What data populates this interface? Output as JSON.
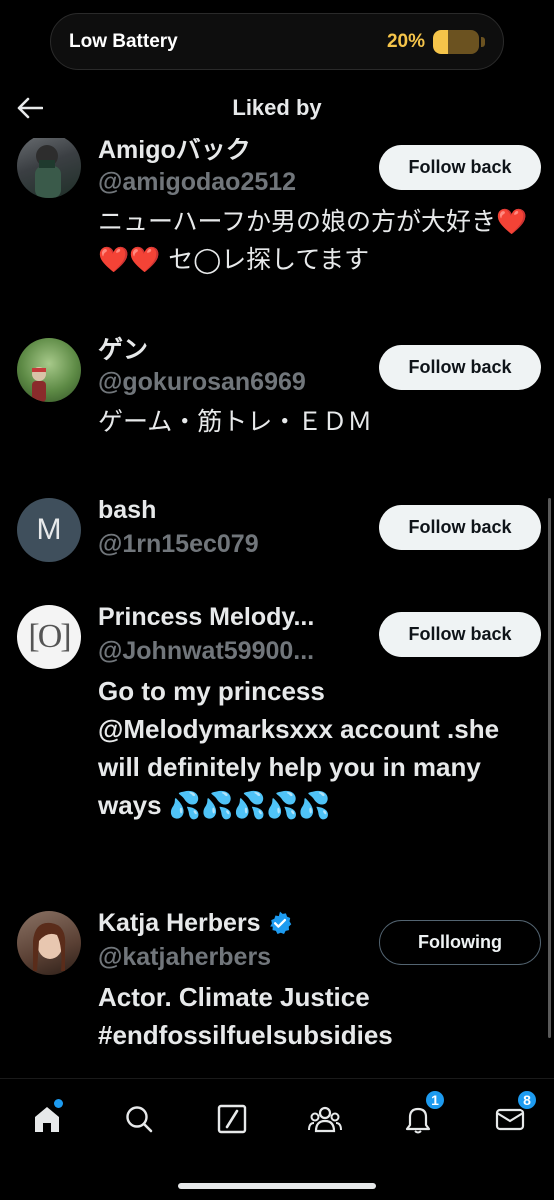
{
  "status": {
    "label": "Low Battery",
    "battery_percent_text": "20%",
    "battery_level": 0.2,
    "battery_color": "#f5c44a"
  },
  "header": {
    "title": "Liked by"
  },
  "users": [
    {
      "name": "Amigoバック",
      "handle": "@amigodao2512",
      "bio": "ニューハーフか男の娘の方が大好き❤️❤️❤️ セ◯レ探してます",
      "button": "Follow back",
      "avatar_icon": "photo-avatar"
    },
    {
      "name": "ゲン",
      "handle": "@gokurosan6969",
      "bio": "ゲーム・筋トレ・ＥＤＭ",
      "button": "Follow back",
      "avatar_icon": "photo-avatar"
    },
    {
      "name": "bash",
      "handle": "@1rn15ec079",
      "bio": "",
      "button": "Follow back",
      "avatar_letter": "M"
    },
    {
      "name": "Princess Melody...",
      "handle": "@Johnwat59900...",
      "bio": "Go to my princess @Melodymarksxxx account .she will definitely help you in many ways 💦💦💦💦💦",
      "button": "Follow back",
      "avatar_letter": "[O]"
    },
    {
      "name": "Katja Herbers",
      "handle": "@katjaherbers",
      "bio": "Actor. Climate Justice #endfossilfuelsubsidies",
      "button": "Following",
      "verified": true
    }
  ],
  "nav": {
    "notifications_badge": "1",
    "messages_badge": "8",
    "accent": "#1d9bf0"
  }
}
